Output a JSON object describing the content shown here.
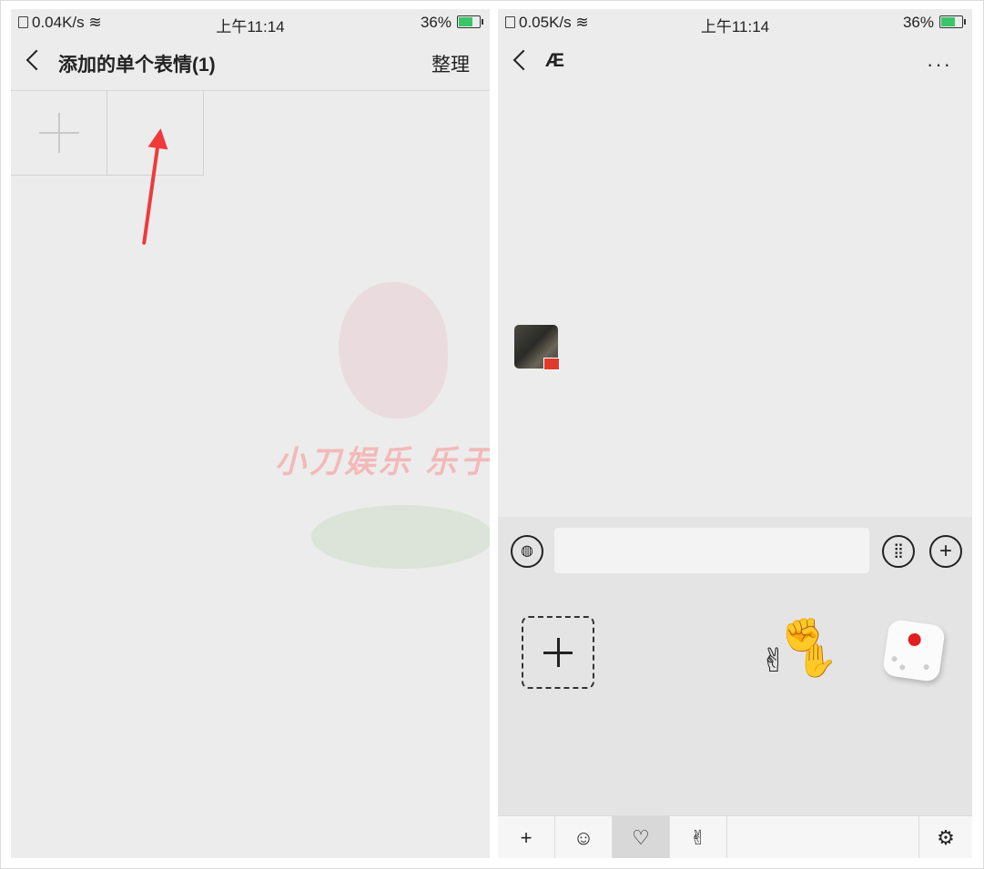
{
  "left": {
    "status": {
      "net": "0.04K/s",
      "time": "上午11:14",
      "battery": "36%"
    },
    "nav": {
      "title": "添加的单个表情(1)",
      "action": "整理"
    },
    "watermark": "小刀娱乐 乐于分享"
  },
  "right": {
    "status": {
      "net": "0.05K/s",
      "time": "上午11:14",
      "battery": "36%"
    },
    "nav": {
      "title": "Æ",
      "more": "···"
    },
    "input": {
      "placeholder": ""
    },
    "stickers": {
      "rps_icon": "rock-paper-scissors",
      "dice_icon": "dice"
    },
    "tabs": {
      "add": "+",
      "emoji": "☺",
      "favorite": "♡",
      "gesture": "✌",
      "settings": "⚙"
    }
  },
  "colors": {
    "arrow": "#f03a3a",
    "panel_bg": "#ececec",
    "input_area_bg": "#e4e4e4"
  }
}
